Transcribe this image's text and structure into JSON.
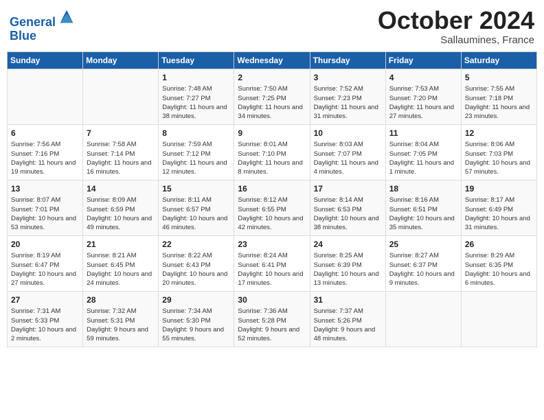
{
  "header": {
    "logo_line1": "General",
    "logo_line2": "Blue",
    "month": "October 2024",
    "location": "Sallaumines, France"
  },
  "weekdays": [
    "Sunday",
    "Monday",
    "Tuesday",
    "Wednesday",
    "Thursday",
    "Friday",
    "Saturday"
  ],
  "weeks": [
    [
      {
        "day": "",
        "info": ""
      },
      {
        "day": "",
        "info": ""
      },
      {
        "day": "1",
        "info": "Sunrise: 7:48 AM\nSunset: 7:27 PM\nDaylight: 11 hours and 38 minutes."
      },
      {
        "day": "2",
        "info": "Sunrise: 7:50 AM\nSunset: 7:25 PM\nDaylight: 11 hours and 34 minutes."
      },
      {
        "day": "3",
        "info": "Sunrise: 7:52 AM\nSunset: 7:23 PM\nDaylight: 11 hours and 31 minutes."
      },
      {
        "day": "4",
        "info": "Sunrise: 7:53 AM\nSunset: 7:20 PM\nDaylight: 11 hours and 27 minutes."
      },
      {
        "day": "5",
        "info": "Sunrise: 7:55 AM\nSunset: 7:18 PM\nDaylight: 11 hours and 23 minutes."
      }
    ],
    [
      {
        "day": "6",
        "info": "Sunrise: 7:56 AM\nSunset: 7:16 PM\nDaylight: 11 hours and 19 minutes."
      },
      {
        "day": "7",
        "info": "Sunrise: 7:58 AM\nSunset: 7:14 PM\nDaylight: 11 hours and 16 minutes."
      },
      {
        "day": "8",
        "info": "Sunrise: 7:59 AM\nSunset: 7:12 PM\nDaylight: 11 hours and 12 minutes."
      },
      {
        "day": "9",
        "info": "Sunrise: 8:01 AM\nSunset: 7:10 PM\nDaylight: 11 hours and 8 minutes."
      },
      {
        "day": "10",
        "info": "Sunrise: 8:03 AM\nSunset: 7:07 PM\nDaylight: 11 hours and 4 minutes."
      },
      {
        "day": "11",
        "info": "Sunrise: 8:04 AM\nSunset: 7:05 PM\nDaylight: 11 hours and 1 minute."
      },
      {
        "day": "12",
        "info": "Sunrise: 8:06 AM\nSunset: 7:03 PM\nDaylight: 10 hours and 57 minutes."
      }
    ],
    [
      {
        "day": "13",
        "info": "Sunrise: 8:07 AM\nSunset: 7:01 PM\nDaylight: 10 hours and 53 minutes."
      },
      {
        "day": "14",
        "info": "Sunrise: 8:09 AM\nSunset: 6:59 PM\nDaylight: 10 hours and 49 minutes."
      },
      {
        "day": "15",
        "info": "Sunrise: 8:11 AM\nSunset: 6:57 PM\nDaylight: 10 hours and 46 minutes."
      },
      {
        "day": "16",
        "info": "Sunrise: 8:12 AM\nSunset: 6:55 PM\nDaylight: 10 hours and 42 minutes."
      },
      {
        "day": "17",
        "info": "Sunrise: 8:14 AM\nSunset: 6:53 PM\nDaylight: 10 hours and 38 minutes."
      },
      {
        "day": "18",
        "info": "Sunrise: 8:16 AM\nSunset: 6:51 PM\nDaylight: 10 hours and 35 minutes."
      },
      {
        "day": "19",
        "info": "Sunrise: 8:17 AM\nSunset: 6:49 PM\nDaylight: 10 hours and 31 minutes."
      }
    ],
    [
      {
        "day": "20",
        "info": "Sunrise: 8:19 AM\nSunset: 6:47 PM\nDaylight: 10 hours and 27 minutes."
      },
      {
        "day": "21",
        "info": "Sunrise: 8:21 AM\nSunset: 6:45 PM\nDaylight: 10 hours and 24 minutes."
      },
      {
        "day": "22",
        "info": "Sunrise: 8:22 AM\nSunset: 6:43 PM\nDaylight: 10 hours and 20 minutes."
      },
      {
        "day": "23",
        "info": "Sunrise: 8:24 AM\nSunset: 6:41 PM\nDaylight: 10 hours and 17 minutes."
      },
      {
        "day": "24",
        "info": "Sunrise: 8:25 AM\nSunset: 6:39 PM\nDaylight: 10 hours and 13 minutes."
      },
      {
        "day": "25",
        "info": "Sunrise: 8:27 AM\nSunset: 6:37 PM\nDaylight: 10 hours and 9 minutes."
      },
      {
        "day": "26",
        "info": "Sunrise: 8:29 AM\nSunset: 6:35 PM\nDaylight: 10 hours and 6 minutes."
      }
    ],
    [
      {
        "day": "27",
        "info": "Sunrise: 7:31 AM\nSunset: 5:33 PM\nDaylight: 10 hours and 2 minutes."
      },
      {
        "day": "28",
        "info": "Sunrise: 7:32 AM\nSunset: 5:31 PM\nDaylight: 9 hours and 59 minutes."
      },
      {
        "day": "29",
        "info": "Sunrise: 7:34 AM\nSunset: 5:30 PM\nDaylight: 9 hours and 55 minutes."
      },
      {
        "day": "30",
        "info": "Sunrise: 7:36 AM\nSunset: 5:28 PM\nDaylight: 9 hours and 52 minutes."
      },
      {
        "day": "31",
        "info": "Sunrise: 7:37 AM\nSunset: 5:26 PM\nDaylight: 9 hours and 48 minutes."
      },
      {
        "day": "",
        "info": ""
      },
      {
        "day": "",
        "info": ""
      }
    ]
  ]
}
